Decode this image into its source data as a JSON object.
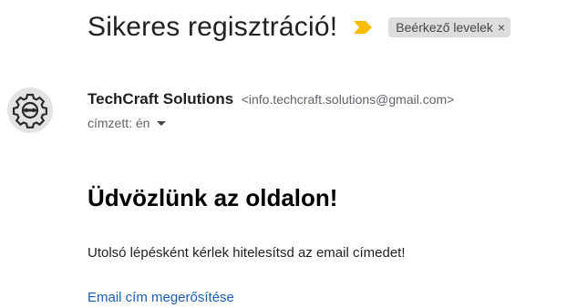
{
  "email": {
    "subject": "Sikeres regisztráció!",
    "label": "Beérkező levelek",
    "label_close": "×",
    "importance_icon": "importance-marker-icon",
    "importance_color": "#fbbc04",
    "sender": {
      "name": "TechCraft Solutions",
      "email": "<info.techcraft.solutions@gmail.com>",
      "avatar_icon": "gear-logo-icon"
    },
    "recipient": "címzett: én",
    "body": {
      "heading": "Üdvözlünk az oldalon!",
      "text": "Utolsó lépésként kérlek hitelesítsd az email címedet!",
      "link": "Email cím megerősítése",
      "link_color": "#1a5fb4"
    }
  }
}
